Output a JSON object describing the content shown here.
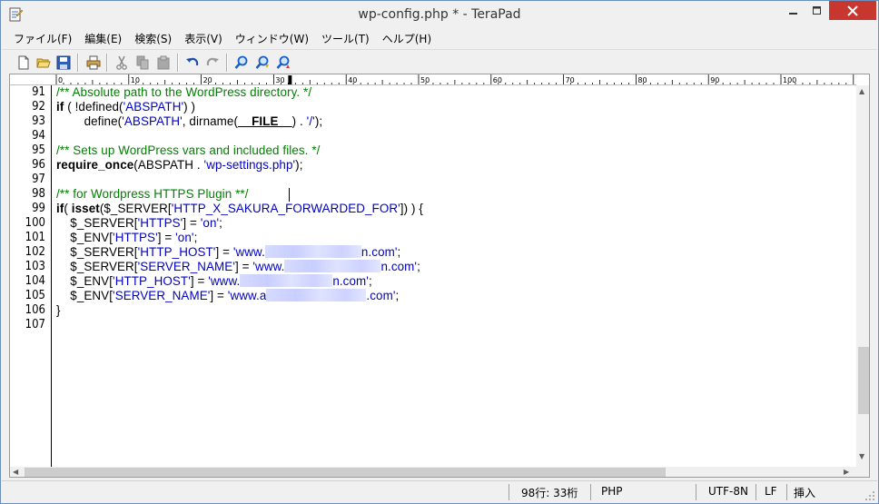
{
  "window": {
    "title": "wp-config.php * - TeraPad"
  },
  "menu": [
    "ファイル(F)",
    "編集(E)",
    "検索(S)",
    "表示(V)",
    "ウィンドウ(W)",
    "ツール(T)",
    "ヘルプ(H)"
  ],
  "toolbar": {
    "icons": [
      "new-file-icon",
      "open-folder-icon",
      "save-icon",
      "print-icon",
      "cut-icon",
      "copy-icon",
      "paste-icon",
      "undo-icon",
      "redo-icon",
      "find-icon",
      "find-next-icon",
      "find-prev-icon"
    ]
  },
  "ruler": {
    "labels": [
      "0",
      "10",
      "20",
      "30",
      "40",
      "50",
      "60",
      "70",
      "80",
      "90",
      "100"
    ]
  },
  "editor": {
    "line_numbers": [
      "91",
      "92",
      "93",
      "94",
      "95",
      "96",
      "97",
      "98",
      "99",
      "100",
      "101",
      "102",
      "103",
      "104",
      "105",
      "106",
      "107"
    ],
    "lines": {
      "l91": "/** Absolute path to the WordPress directory. */",
      "l92a": "if",
      "l92b": " ( !defined(",
      "l92c": "'ABSPATH'",
      "l92d": ") )",
      "l93a": "        define(",
      "l93b": "'ABSPATH'",
      "l93c": ", dirname(",
      "l93d": "__FILE__",
      "l93e": ") . ",
      "l93f": "'/'",
      "l93g": ");",
      "l95": "/** Sets up WordPress vars and included files. */",
      "l96a": "require_once",
      "l96b": "(ABSPATH . ",
      "l96c": "'wp-settings.php'",
      "l96d": ");",
      "l98a": "/** for Wordpress HTTPS Plugin *",
      "l98b": "*/",
      "l99a": "if",
      "l99b": "( ",
      "l99c": "isset",
      "l99d": "($_SERVER[",
      "l99e": "'HTTP_X_SAKURA_FORWARDED_FOR'",
      "l99f": "]) ) {",
      "l100a": "    $_SERVER[",
      "l100b": "'HTTPS'",
      "l100c": "] = ",
      "l100d": "'on'",
      "l100e": ";",
      "l101a": "    $_ENV[",
      "l101b": "'HTTPS'",
      "l101c": "] = ",
      "l101d": "'on'",
      "l101e": ";",
      "l102a": "    $_SERVER[",
      "l102b": "'HTTP_HOST'",
      "l102c": "] = ",
      "l102d": "'www.",
      "l102e": "n.com'",
      "l102f": ";",
      "l103a": "    $_SERVER[",
      "l103b": "'SERVER_NAME'",
      "l103c": "] = ",
      "l103d": "'www.",
      "l103e": "n.com'",
      "l103f": ";",
      "l104a": "    $_ENV[",
      "l104b": "'HTTP_HOST'",
      "l104c": "] = ",
      "l104d": "'www.",
      "l104e": "n.com'",
      "l104f": ";",
      "l105a": "    $_ENV[",
      "l105b": "'SERVER_NAME'",
      "l105c": "] = ",
      "l105d": "'www.a",
      "l105e": ".com'",
      "l105f": ";",
      "l106": "}"
    }
  },
  "status": {
    "position": "98行:   33桁",
    "syntax": "PHP",
    "encoding": "UTF-8N",
    "newline": "LF",
    "mode": "挿入"
  },
  "colors": {
    "comment": "#008000",
    "string": "#0000c8",
    "close_button": "#c7362f"
  }
}
